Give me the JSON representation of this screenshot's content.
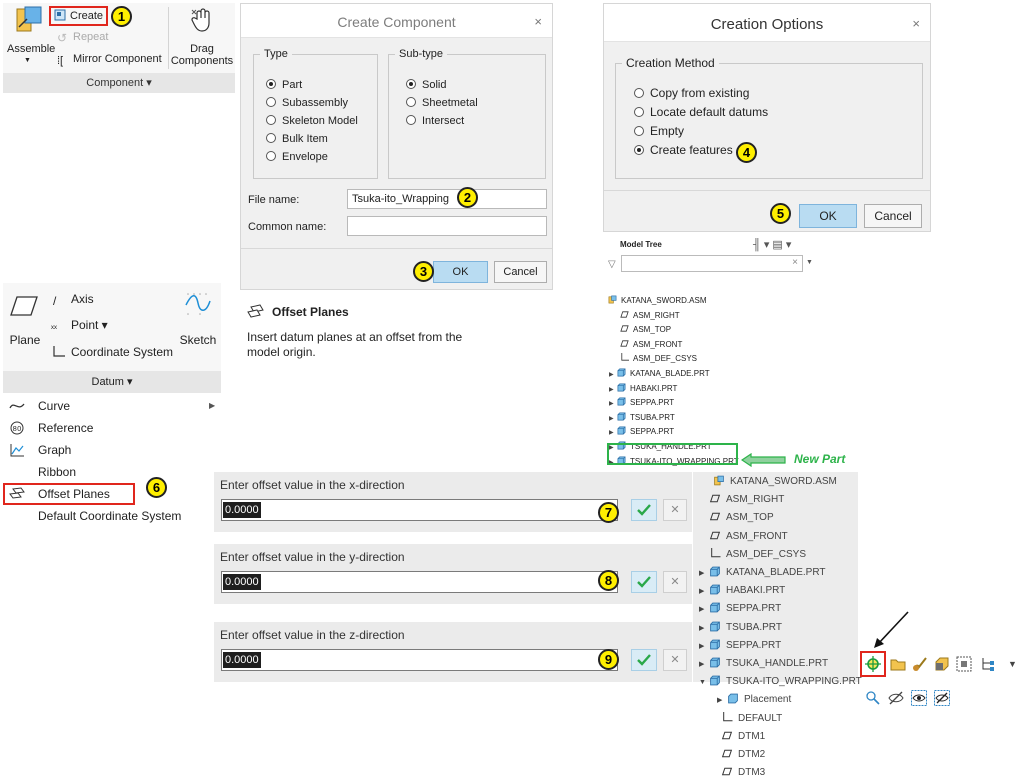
{
  "ribbon_component": {
    "create": "Create",
    "repeat": "Repeat",
    "mirror_component": "Mirror Component",
    "assemble": "Assemble",
    "drag_components": "Drag\nComponents",
    "group_label": "Component ▾"
  },
  "callouts": [
    "1",
    "2",
    "3",
    "4",
    "5",
    "6",
    "7",
    "8",
    "9"
  ],
  "create_component": {
    "title": "Create Component",
    "close": "×",
    "type_legend": "Type",
    "types": [
      "Part",
      "Subassembly",
      "Skeleton Model",
      "Bulk Item",
      "Envelope"
    ],
    "selected_type": "Part",
    "subtype_legend": "Sub-type",
    "subtypes": [
      "Solid",
      "Sheetmetal",
      "Intersect"
    ],
    "selected_subtype": "Solid",
    "file_name_label": "File name:",
    "file_name_value": "Tsuka-ito_Wrapping",
    "common_name_label": "Common name:",
    "common_name_value": "",
    "ok": "OK",
    "cancel": "Cancel"
  },
  "creation_options": {
    "title": "Creation Options",
    "close": "×",
    "method_legend": "Creation Method",
    "methods": [
      "Copy from existing",
      "Locate default datums",
      "Empty",
      "Create features"
    ],
    "selected_method": "Create features",
    "ok": "OK",
    "cancel": "Cancel"
  },
  "model_tree": {
    "title": "Model Tree",
    "filter_clear": "×",
    "items": [
      {
        "label": "KATANA_SWORD.ASM",
        "kind": "asm",
        "level": 0,
        "arrow": ""
      },
      {
        "label": "ASM_RIGHT",
        "kind": "plane",
        "level": 1,
        "arrow": ""
      },
      {
        "label": "ASM_TOP",
        "kind": "plane",
        "level": 1,
        "arrow": ""
      },
      {
        "label": "ASM_FRONT",
        "kind": "plane",
        "level": 1,
        "arrow": ""
      },
      {
        "label": "ASM_DEF_CSYS",
        "kind": "csys",
        "level": 1,
        "arrow": ""
      },
      {
        "label": "KATANA_BLADE.PRT",
        "kind": "prt",
        "level": 0,
        "arrow": "▶"
      },
      {
        "label": "HABAKI.PRT",
        "kind": "prt",
        "level": 0,
        "arrow": "▶"
      },
      {
        "label": "SEPPA.PRT",
        "kind": "prt",
        "level": 0,
        "arrow": "▶"
      },
      {
        "label": "TSUBA.PRT",
        "kind": "prt",
        "level": 0,
        "arrow": "▶"
      },
      {
        "label": "SEPPA.PRT",
        "kind": "prt",
        "level": 0,
        "arrow": "▶"
      },
      {
        "label": "TSUKA_HANDLE.PRT",
        "kind": "prt",
        "level": 0,
        "arrow": "▶"
      },
      {
        "label": "TSUKA-ITO_WRAPPING.PRT",
        "kind": "prt",
        "level": 0,
        "arrow": "▶"
      }
    ],
    "new_part_label": "New Part"
  },
  "offset_planes_tip": {
    "title": "Offset Planes",
    "description": "Insert datum planes at an offset from the model origin."
  },
  "datum_group": {
    "plane": "Plane",
    "axis": "Axis",
    "point": "Point ▾",
    "coordinate_system": "Coordinate System",
    "sketch": "Sketch",
    "group_label": "Datum ▾"
  },
  "datum_menu": [
    "Curve",
    "Reference",
    "Graph",
    "Ribbon",
    "Offset Planes",
    "Default Coordinate System"
  ],
  "offset_inputs": [
    {
      "label": "Enter offset value in the x-direction",
      "value": "0.0000"
    },
    {
      "label": "Enter offset value in the y-direction",
      "value": "0.0000"
    },
    {
      "label": "Enter offset value in the z-direction",
      "value": "0.0000"
    }
  ],
  "model_tree_2": {
    "items": [
      {
        "label": "KATANA_SWORD.ASM",
        "kind": "asm",
        "arrow": ""
      },
      {
        "label": "ASM_RIGHT",
        "kind": "plane",
        "arrow": ""
      },
      {
        "label": "ASM_TOP",
        "kind": "plane",
        "arrow": ""
      },
      {
        "label": "ASM_FRONT",
        "kind": "plane",
        "arrow": ""
      },
      {
        "label": "ASM_DEF_CSYS",
        "kind": "csys",
        "arrow": ""
      },
      {
        "label": "KATANA_BLADE.PRT",
        "kind": "prt",
        "arrow": "▶"
      },
      {
        "label": "HABAKI.PRT",
        "kind": "prt",
        "arrow": "▶"
      },
      {
        "label": "SEPPA.PRT",
        "kind": "prt",
        "arrow": "▶"
      },
      {
        "label": "TSUBA.PRT",
        "kind": "prt",
        "arrow": "▶"
      },
      {
        "label": "SEPPA.PRT",
        "kind": "prt",
        "arrow": "▶"
      },
      {
        "label": "TSUKA_HANDLE.PRT",
        "kind": "prt",
        "arrow": "▶"
      },
      {
        "label": "TSUKA-ITO_WRAPPING.PRT",
        "kind": "prt",
        "arrow": "▼"
      },
      {
        "label": "Placement",
        "kind": "folder",
        "arrow": "▶"
      },
      {
        "label": "DEFAULT",
        "kind": "csys",
        "arrow": ""
      },
      {
        "label": "DTM1",
        "kind": "plane",
        "arrow": ""
      },
      {
        "label": "DTM2",
        "kind": "plane",
        "arrow": ""
      },
      {
        "label": "DTM3",
        "kind": "plane",
        "arrow": ""
      }
    ]
  },
  "colors": {
    "callout": "#ffef00",
    "highlight_red": "#e0261d",
    "new_part_green": "#2db34a",
    "ok_blue": "#b9dcf2"
  }
}
